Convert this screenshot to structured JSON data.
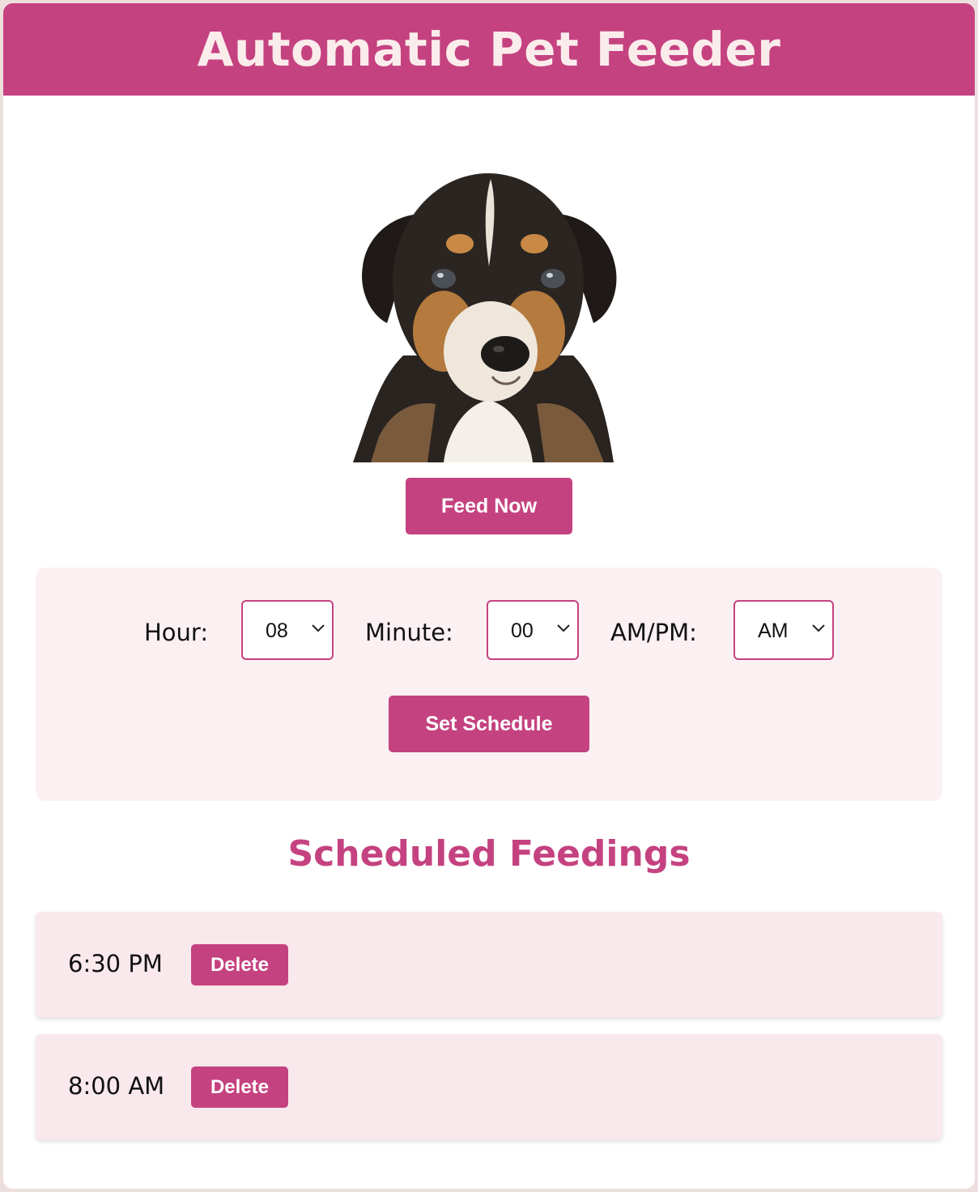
{
  "header": {
    "title": "Automatic Pet Feeder"
  },
  "pet": {
    "image_alt": "puppy-photo"
  },
  "actions": {
    "feed_now_label": "Feed Now"
  },
  "schedule_form": {
    "hour_label": "Hour:",
    "hour_value": "08",
    "minute_label": "Minute:",
    "minute_value": "00",
    "ampm_label": "AM/PM:",
    "ampm_value": "AM",
    "submit_label": "Set Schedule"
  },
  "scheduled": {
    "title": "Scheduled Feedings",
    "items": [
      {
        "time": "6:30 PM",
        "delete_label": "Delete"
      },
      {
        "time": "8:00 AM",
        "delete_label": "Delete"
      }
    ]
  },
  "icons": {
    "select_chevron": "chevron-down-icon"
  },
  "colors": {
    "accent": "#c54280",
    "header_text": "#fbecec",
    "panel_bg": "#fbf0f2",
    "item_bg": "#f9e8ec",
    "page_bg": "#ecdfdd"
  }
}
